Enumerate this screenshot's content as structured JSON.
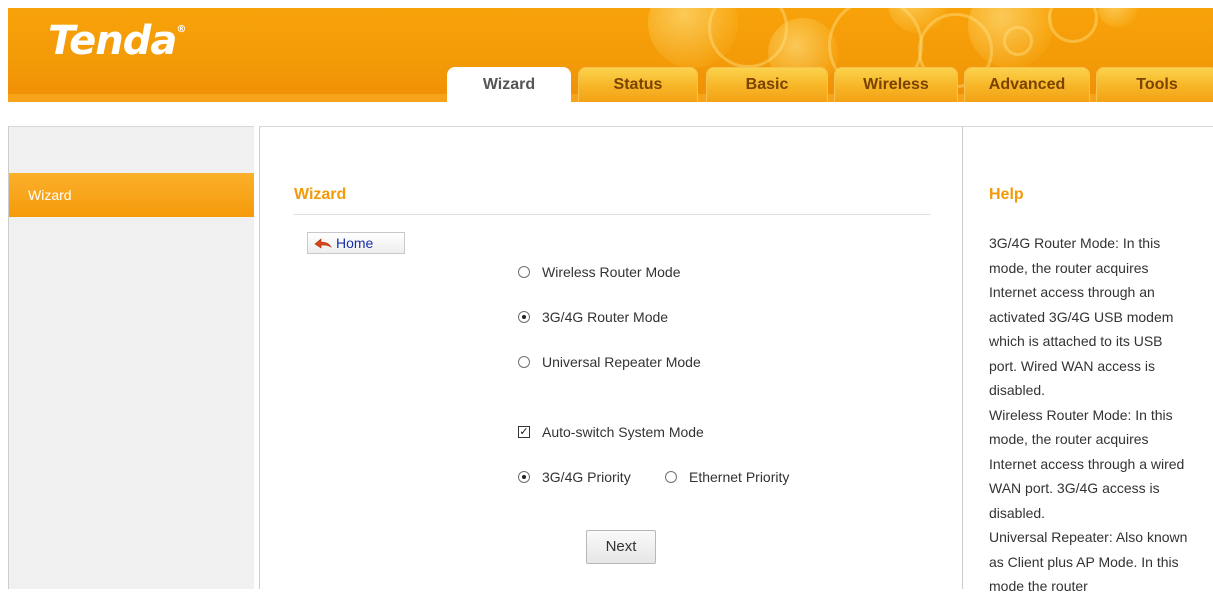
{
  "brand": {
    "logo_text": "Tenda",
    "logo_mark": "®"
  },
  "nav": {
    "tabs": [
      {
        "label": "Wizard",
        "active": true
      },
      {
        "label": "Status",
        "active": false
      },
      {
        "label": "Basic",
        "active": false
      },
      {
        "label": "Wireless",
        "active": false
      },
      {
        "label": "Advanced",
        "active": false
      },
      {
        "label": "Tools",
        "active": false
      }
    ]
  },
  "sidebar": {
    "items": [
      {
        "label": "Wizard",
        "active": true
      }
    ]
  },
  "main": {
    "title": "Wizard",
    "home_label": "Home",
    "modes": [
      {
        "label": "Wireless Router Mode",
        "checked": false
      },
      {
        "label": "3G/4G Router Mode",
        "checked": true
      },
      {
        "label": "Universal Repeater Mode",
        "checked": false
      }
    ],
    "auto_switch": {
      "label": "Auto-switch System Mode",
      "checked": true
    },
    "priority": [
      {
        "label": "3G/4G Priority",
        "checked": true
      },
      {
        "label": "Ethernet Priority",
        "checked": false
      }
    ],
    "next_label": "Next"
  },
  "help": {
    "title": "Help",
    "paragraphs": [
      "3G/4G Router Mode: In this mode, the router acquires Internet access through an activated 3G/4G USB modem which is attached to its USB port. Wired WAN access is disabled.",
      "Wireless Router Mode: In this mode, the router acquires Internet access through a wired WAN port. 3G/4G access is disabled.",
      "Universal Repeater: Also known as Client plus AP Mode. In this mode the router"
    ]
  },
  "colors": {
    "accent": "#f39a08",
    "header_orange": "#f8a20a",
    "link_blue": "#1a2ea8"
  }
}
